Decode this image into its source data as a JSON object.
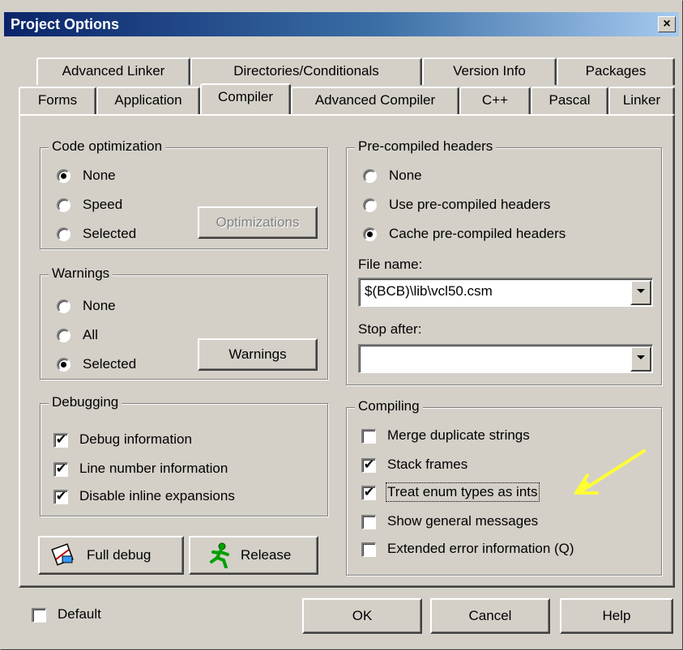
{
  "window": {
    "title": "Project Options",
    "close_label": "×"
  },
  "tabs_row1": [
    "Advanced Linker",
    "Directories/Conditionals",
    "Version Info",
    "Packages"
  ],
  "tabs_row2": [
    "Forms",
    "Application",
    "Compiler",
    "Advanced Compiler",
    "C++",
    "Pascal",
    "Linker"
  ],
  "active_tab": "Compiler",
  "code_optimization": {
    "legend": "Code optimization",
    "options": [
      "None",
      "Speed",
      "Selected"
    ],
    "selected": "None",
    "button": "Optimizations",
    "button_enabled": false
  },
  "warnings": {
    "legend": "Warnings",
    "options": [
      "None",
      "All",
      "Selected"
    ],
    "selected": "Selected",
    "button": "Warnings"
  },
  "debugging": {
    "legend": "Debugging",
    "items": [
      {
        "label": "Debug information",
        "checked": true
      },
      {
        "label": "Line number information",
        "checked": true
      },
      {
        "label": "Disable inline expansions",
        "checked": true
      }
    ]
  },
  "buttons": {
    "full_debug": "Full debug",
    "release": "Release"
  },
  "precompiled_headers": {
    "legend": "Pre-compiled headers",
    "options": [
      "None",
      "Use pre-compiled headers",
      "Cache pre-compiled headers"
    ],
    "selected": "Cache pre-compiled headers",
    "file_name_label": "File name:",
    "file_name_value": "$(BCB)\\lib\\vcl50.csm",
    "stop_after_label": "Stop after:",
    "stop_after_value": ""
  },
  "compiling": {
    "legend": "Compiling",
    "items": [
      {
        "label": "Merge duplicate strings",
        "checked": false
      },
      {
        "label": "Stack frames",
        "checked": true
      },
      {
        "label": "Treat enum types as ints",
        "checked": true
      },
      {
        "label": "Show general messages",
        "checked": false
      },
      {
        "label": "Extended error information (Q)",
        "checked": false
      }
    ]
  },
  "footer": {
    "default_label": "Default",
    "default_checked": false,
    "ok": "OK",
    "cancel": "Cancel",
    "help": "Help"
  },
  "annotation": {
    "arrow_color": "#ffff33"
  },
  "check_mark": "✔"
}
